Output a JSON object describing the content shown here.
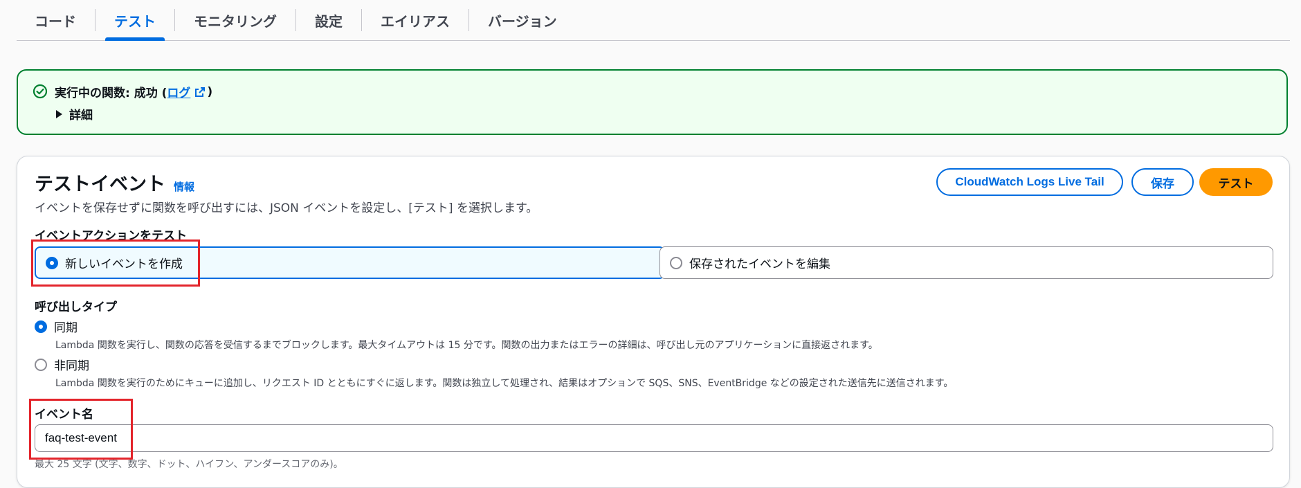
{
  "tabs": [
    {
      "label": "コード"
    },
    {
      "label": "テスト"
    },
    {
      "label": "モニタリング"
    },
    {
      "label": "設定"
    },
    {
      "label": "エイリアス"
    },
    {
      "label": "バージョン"
    }
  ],
  "alert": {
    "title_prefix": "実行中の関数: 成功 (",
    "log_link": "ログ",
    "title_suffix": ")",
    "details_label": "詳細"
  },
  "test_event": {
    "title": "テストイベント",
    "info_link": "情報",
    "description": "イベントを保存せずに関数を呼び出すには、JSON イベントを設定し、[テスト] を選択します。",
    "buttons": {
      "cloudwatch": "CloudWatch Logs Live Tail",
      "save": "保存",
      "test": "テスト"
    },
    "action_label": "イベントアクションをテスト",
    "action_options": [
      {
        "label": "新しいイベントを作成",
        "selected": true
      },
      {
        "label": "保存されたイベントを編集",
        "selected": false
      }
    ],
    "invocation_label": "呼び出しタイプ",
    "invocation_options": [
      {
        "label": "同期",
        "selected": true,
        "description": "Lambda 関数を実行し、関数の応答を受信するまでブロックします。最大タイムアウトは 15 分です。関数の出力またはエラーの詳細は、呼び出し元のアプリケーションに直接返されます。"
      },
      {
        "label": "非同期",
        "selected": false,
        "description": "Lambda 関数を実行のためにキューに追加し、リクエスト ID とともにすぐに返します。関数は独立して処理され、結果はオプションで SQS、SNS、EventBridge などの設定された送信先に送信されます。"
      }
    ],
    "event_name_label": "イベント名",
    "event_name_value": "faq-test-event",
    "event_name_constraint": "最大 25 文字 (文字、数字、ドット、ハイフン、アンダースコアのみ)。"
  },
  "colors": {
    "accent": "#006ce0",
    "success": "#00802f",
    "primary_button": "#ff9900",
    "highlight": "#e3242b"
  },
  "icons": {
    "success": "check-circle-icon",
    "external_link": "external-link-icon",
    "expand": "caret-right-icon"
  }
}
